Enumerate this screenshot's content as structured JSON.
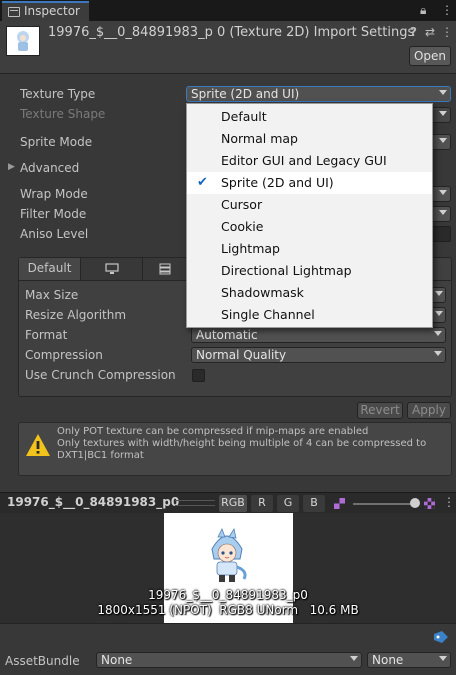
{
  "window": {
    "tab_label": "Inspector"
  },
  "header": {
    "title": "19976_$__0_84891983_p 0 (Texture 2D) Import Settings",
    "open_label": "Open"
  },
  "fields": {
    "texture_type_label": "Texture Type",
    "texture_type_value": "Sprite (2D and UI)",
    "texture_shape_label": "Texture Shape",
    "sprite_mode_label": "Sprite Mode",
    "advanced_label": "Advanced",
    "wrap_mode_label": "Wrap Mode",
    "filter_mode_label": "Filter Mode",
    "aniso_level_label": "Aniso Level"
  },
  "platform_panel": {
    "tabs": [
      "Default"
    ],
    "max_size_label": "Max Size",
    "resize_algorithm_label": "Resize Algorithm",
    "format_label": "Format",
    "format_value": "Automatic",
    "compression_label": "Compression",
    "compression_value": "Normal Quality",
    "crunch_label": "Use Crunch Compression"
  },
  "actions": {
    "revert_label": "Revert",
    "apply_label": "Apply"
  },
  "warning": {
    "lines": [
      "Only POT texture can be compressed if mip-maps are enabled",
      "Only textures with width/height being multiple of 4 can be compressed to",
      "DXT1|BC1 format"
    ]
  },
  "preview": {
    "name": "19976_$__0_84891983_p0",
    "channel_buttons": [
      "RGB",
      "R",
      "G",
      "B"
    ],
    "caption_name": "19976_$__0_84891983_p0",
    "caption_info": "1800x1551 (NPOT)  RGB8 UNorm   10.6 MB",
    "mip_level_fraction": 1.0
  },
  "bottom": {
    "assetbundle_label": "AssetBundle",
    "assetbundle_value": "None",
    "variant_value": "None"
  },
  "dropdown_menu": {
    "items": [
      {
        "label": "Default",
        "selected": false
      },
      {
        "label": "Normal map",
        "selected": false
      },
      {
        "label": "Editor GUI and Legacy GUI",
        "selected": false
      },
      {
        "label": "Sprite (2D and UI)",
        "selected": true
      },
      {
        "label": "Cursor",
        "selected": false
      },
      {
        "label": "Cookie",
        "selected": false
      },
      {
        "label": "Lightmap",
        "selected": false
      },
      {
        "label": "Directional Lightmap",
        "selected": false
      },
      {
        "label": "Shadowmask",
        "selected": false
      },
      {
        "label": "Single Channel",
        "selected": false
      }
    ],
    "check_glyph": "✔"
  },
  "colors": {
    "accent": "#3a79bb",
    "check": "#1565c0",
    "warning": "#f2c31a"
  }
}
